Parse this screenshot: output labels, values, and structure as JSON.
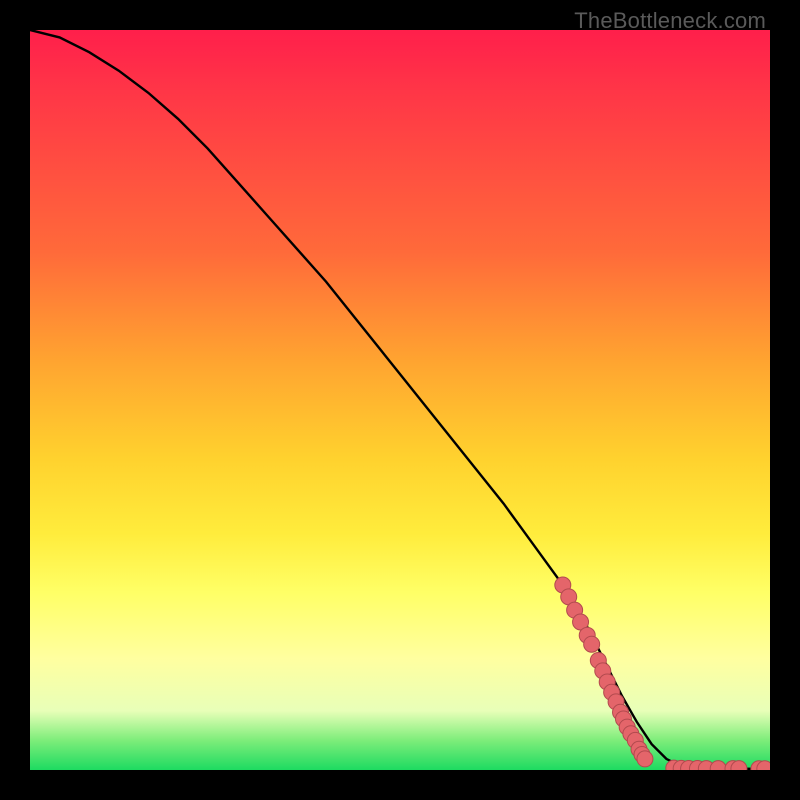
{
  "watermark": "TheBottleneck.com",
  "colors": {
    "line": "#000000",
    "marker_fill": "#e4656a",
    "marker_stroke": "#b24a4e",
    "gradient_top": "#ff1f4b",
    "gradient_mid": "#ffd22e",
    "gradient_bottom": "#1ddb61"
  },
  "chart_data": {
    "type": "line",
    "title": "",
    "xlabel": "",
    "ylabel": "",
    "xlim": [
      0,
      100
    ],
    "ylim": [
      0,
      100
    ],
    "grid": false,
    "curve": {
      "x": [
        0,
        4,
        8,
        12,
        16,
        20,
        24,
        28,
        32,
        36,
        40,
        44,
        48,
        52,
        56,
        60,
        64,
        68,
        72,
        75.5,
        78,
        80,
        82,
        84,
        86,
        88,
        90,
        92,
        94,
        96,
        98,
        100
      ],
      "y": [
        100,
        99,
        97,
        94.5,
        91.5,
        88,
        84,
        79.5,
        75,
        70.5,
        66,
        61,
        56,
        51,
        46,
        41,
        36,
        30.5,
        25,
        19,
        14,
        10,
        6.5,
        3.5,
        1.5,
        0.5,
        0.25,
        0.2,
        0.18,
        0.17,
        0.16,
        0.15
      ]
    },
    "markers": [
      {
        "x": 72.0,
        "y": 25.0
      },
      {
        "x": 72.8,
        "y": 23.4
      },
      {
        "x": 73.6,
        "y": 21.6
      },
      {
        "x": 74.4,
        "y": 20.0
      },
      {
        "x": 75.3,
        "y": 18.2
      },
      {
        "x": 75.9,
        "y": 17.0
      },
      {
        "x": 76.8,
        "y": 14.8
      },
      {
        "x": 77.4,
        "y": 13.4
      },
      {
        "x": 78.0,
        "y": 11.9
      },
      {
        "x": 78.6,
        "y": 10.5
      },
      {
        "x": 79.2,
        "y": 9.2
      },
      {
        "x": 79.8,
        "y": 7.8
      },
      {
        "x": 80.2,
        "y": 6.9
      },
      {
        "x": 80.7,
        "y": 5.8
      },
      {
        "x": 81.2,
        "y": 4.9
      },
      {
        "x": 81.8,
        "y": 4.0
      },
      {
        "x": 82.3,
        "y": 2.8
      },
      {
        "x": 82.7,
        "y": 2.1
      },
      {
        "x": 83.1,
        "y": 1.5
      },
      {
        "x": 87.0,
        "y": 0.25
      },
      {
        "x": 88.0,
        "y": 0.22
      },
      {
        "x": 89.0,
        "y": 0.2
      },
      {
        "x": 90.2,
        "y": 0.2
      },
      {
        "x": 91.4,
        "y": 0.19
      },
      {
        "x": 93.0,
        "y": 0.18
      },
      {
        "x": 95.0,
        "y": 0.18
      },
      {
        "x": 95.8,
        "y": 0.18
      },
      {
        "x": 98.5,
        "y": 0.17
      },
      {
        "x": 99.3,
        "y": 0.17
      }
    ],
    "marker_style": {
      "shape": "circle",
      "fill": "#e4656a",
      "stroke": "#b24a4e",
      "size": 8
    }
  }
}
